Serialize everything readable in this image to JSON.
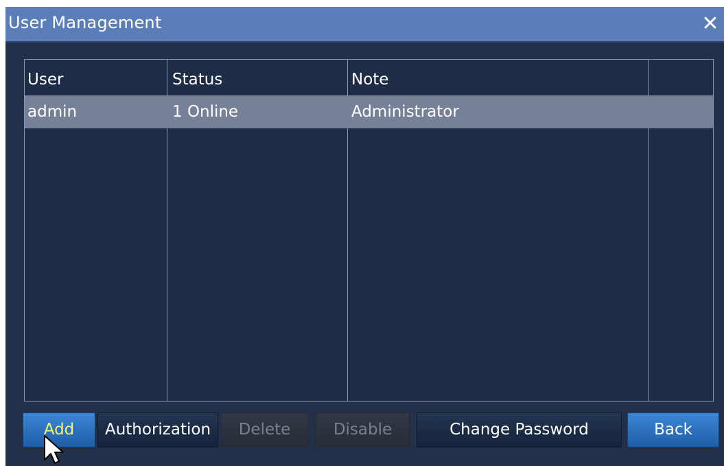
{
  "window": {
    "title": "User Management",
    "close_icon": "close-icon"
  },
  "table": {
    "columns": [
      "User",
      "Status",
      "Note",
      ""
    ],
    "rows": [
      {
        "user": "admin",
        "status": "1  Online",
        "note": "Administrator",
        "extra": ""
      }
    ]
  },
  "buttons": {
    "add": "Add",
    "authorization": "Authorization",
    "delete": "Delete",
    "disable": "Disable",
    "change_password": "Change  Password",
    "back": "Back"
  },
  "colors": {
    "title_bar": "#5b7db8",
    "background": "#223049",
    "selected_row": "#768198",
    "blue_button": "#2d73c4",
    "active_text": "#f4f56a"
  },
  "pointer": {
    "icon": "mouse-pointer-icon"
  }
}
